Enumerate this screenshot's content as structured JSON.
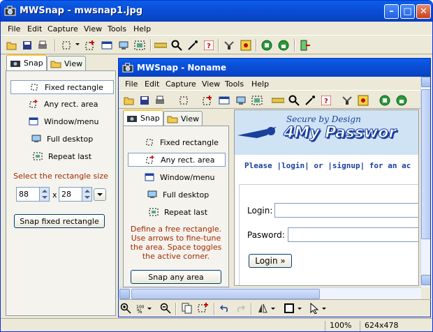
{
  "window": {
    "title": "MWSnap - mwsnap1.jpg"
  },
  "menu": [
    "File",
    "Edit",
    "Capture",
    "View",
    "Tools",
    "Help"
  ],
  "tabs": {
    "snap": "Snap",
    "view": "View"
  },
  "left": {
    "options": [
      "Fixed rectangle",
      "Any rect. area",
      "Window/menu",
      "Full desktop",
      "Repeat last"
    ],
    "hint": "Select the rectangle size",
    "width_value": "88",
    "height_value": "28",
    "by": "x",
    "button": "Snap fixed rectangle"
  },
  "inner": {
    "title": "MWSnap - Noname",
    "menu": [
      "File",
      "Edit",
      "Capture",
      "View",
      "Tools",
      "Help"
    ],
    "tabs": {
      "snap": "Snap",
      "view": "View"
    },
    "options": [
      "Fixed rectangle",
      "Any rect. area",
      "Window/menu",
      "Full desktop",
      "Repeat last"
    ],
    "hint": "Define a free rectangle. Use arrows to fine-tune the area. Space toggles the active corner.",
    "button": "Snap any area"
  },
  "web": {
    "tagline": "Secure by Design",
    "brand": "4My Passwor",
    "links_text": "Please |login| or |signup| for an ac",
    "login_label": "Login:",
    "password_label": "Pasword:",
    "login_button": "Login »"
  },
  "status": {
    "zoom": "100%",
    "size": "624x478"
  },
  "colors": {
    "titlebar": "#0a4fd8",
    "hint_red": "#a52a00",
    "web_blue": "#1a3f9c",
    "banner": "#cfe3f4"
  }
}
